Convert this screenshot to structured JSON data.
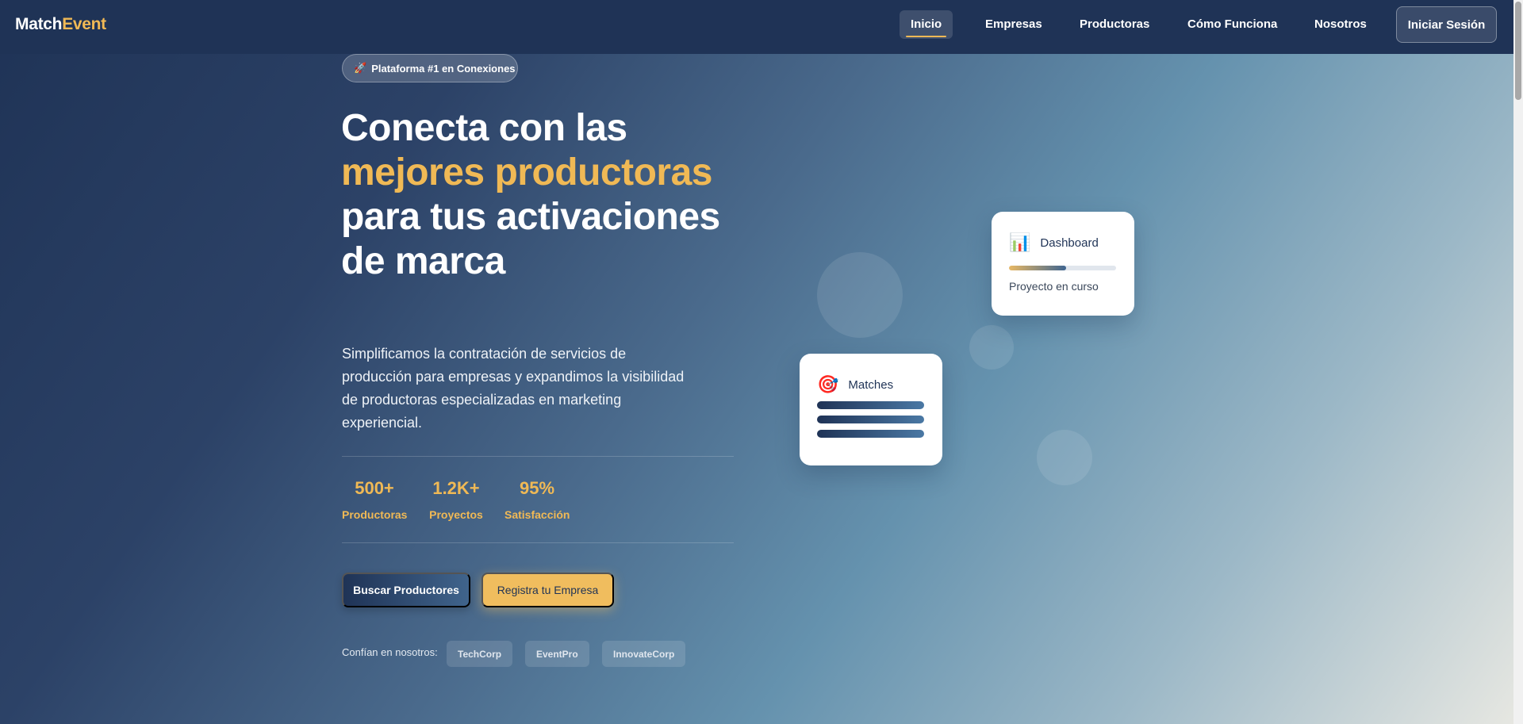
{
  "nav": {
    "logo_part1": "Match",
    "logo_part2": "Event",
    "items": [
      {
        "label": "Inicio",
        "active": true
      },
      {
        "label": "Empresas"
      },
      {
        "label": "Productoras"
      },
      {
        "label": "Cómo Funciona"
      },
      {
        "label": "Nosotros"
      }
    ],
    "login_label": "Iniciar Sesión"
  },
  "hero": {
    "badge_icon": "🚀",
    "badge_text": "Plataforma #1 en Conexiones",
    "headline_part1": "Conecta con las ",
    "headline_highlight": "mejores productoras",
    "headline_part2": " para tus activaciones de marca",
    "subtitle": "Simplificamos la contratación de servicios de producción para empresas y expandimos la visibilidad de productoras especializadas en marketing experiencial.",
    "stats": [
      {
        "value": "500+",
        "label": "Productoras"
      },
      {
        "value": "1.2K+",
        "label": "Proyectos"
      },
      {
        "value": "95%",
        "label": "Satisfacción"
      }
    ],
    "primary_cta": "Buscar Productores",
    "secondary_cta": "Registra tu Empresa",
    "trust_label": "Confían en nosotros:",
    "trust_logos": [
      "TechCorp",
      "EventPro",
      "InnovateCorp"
    ]
  },
  "cards": {
    "dashboard": {
      "icon": "📊",
      "title": "Dashboard",
      "note": "Proyecto en curso",
      "progress": 0.53
    },
    "matches": {
      "icon": "🎯",
      "title": "Matches"
    }
  },
  "colors": {
    "navy": "#1f3356",
    "accent": "#f0b955"
  }
}
